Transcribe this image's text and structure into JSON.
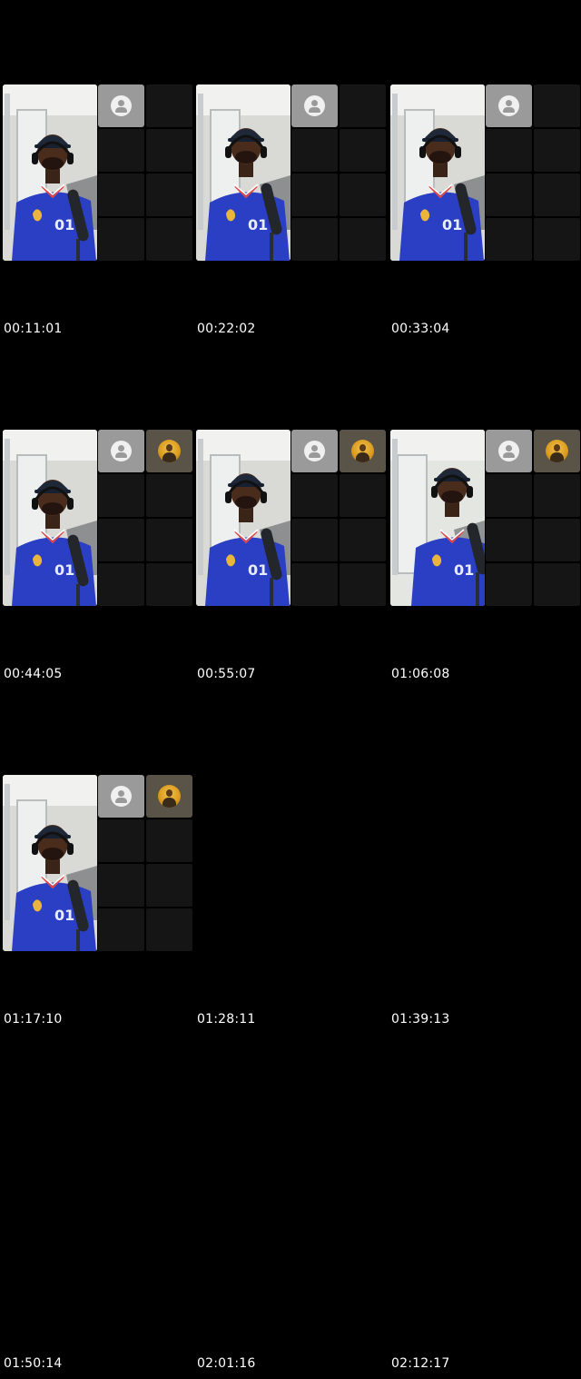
{
  "contact_sheet": {
    "frames": [
      {
        "timestamp": "00:11:01",
        "has_thumbnail": true,
        "has_photo_avatar": false,
        "variant": "a"
      },
      {
        "timestamp": "00:22:02",
        "has_thumbnail": true,
        "has_photo_avatar": false,
        "variant": "b"
      },
      {
        "timestamp": "00:33:04",
        "has_thumbnail": true,
        "has_photo_avatar": false,
        "variant": "b"
      },
      {
        "timestamp": "00:44:05",
        "has_thumbnail": true,
        "has_photo_avatar": true,
        "variant": "a"
      },
      {
        "timestamp": "00:55:07",
        "has_thumbnail": true,
        "has_photo_avatar": true,
        "variant": "b"
      },
      {
        "timestamp": "01:06:08",
        "has_thumbnail": true,
        "has_photo_avatar": true,
        "variant": "c"
      },
      {
        "timestamp": "01:17:10",
        "has_thumbnail": true,
        "has_photo_avatar": true,
        "variant": "a"
      },
      {
        "timestamp": "01:28:11",
        "has_thumbnail": false,
        "has_photo_avatar": false,
        "variant": ""
      },
      {
        "timestamp": "01:39:13",
        "has_thumbnail": false,
        "has_photo_avatar": false,
        "variant": ""
      },
      {
        "timestamp": "01:50:14",
        "has_thumbnail": false,
        "has_photo_avatar": false,
        "variant": ""
      },
      {
        "timestamp": "02:01:16",
        "has_thumbnail": false,
        "has_photo_avatar": false,
        "variant": ""
      },
      {
        "timestamp": "02:12:17",
        "has_thumbnail": false,
        "has_photo_avatar": false,
        "variant": ""
      }
    ],
    "icons": {
      "placeholder_avatar": "user-placeholder-icon",
      "photo_avatar": "user-photo-avatar"
    },
    "colors": {
      "background": "#000000",
      "jersey_blue": "#2a3fc4",
      "tile_dark": "#151515",
      "placeholder_gray": "#9a9a9a",
      "timestamp_text": "#ffffff"
    }
  }
}
